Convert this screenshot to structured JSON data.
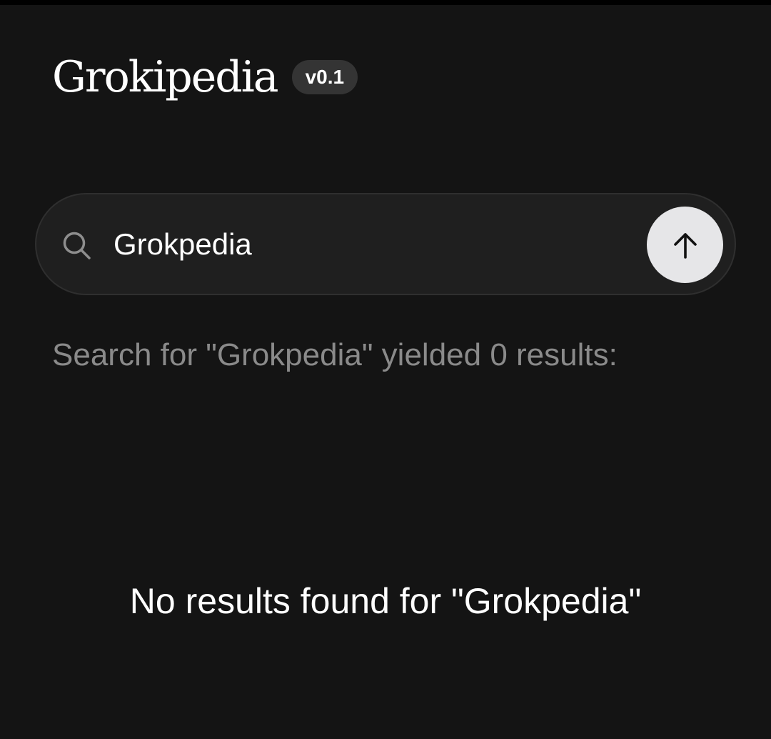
{
  "header": {
    "logo_text": "Grokipedia",
    "version_badge": "v0.1"
  },
  "search": {
    "query": "Grokpedia",
    "search_icon": "search-icon",
    "submit_icon": "arrow-up-icon"
  },
  "results": {
    "summary": "Search for \"Grokpedia\" yielded 0 results:",
    "count": 0,
    "empty_message": "No results found for \"Grokpedia\""
  },
  "colors": {
    "background": "#141414",
    "search_bar_background": "#1f1f1f",
    "search_bar_border": "#2f2f2f",
    "badge_background": "#343434",
    "submit_button": "#e6e6e8",
    "muted_text": "#8a8a8a"
  }
}
